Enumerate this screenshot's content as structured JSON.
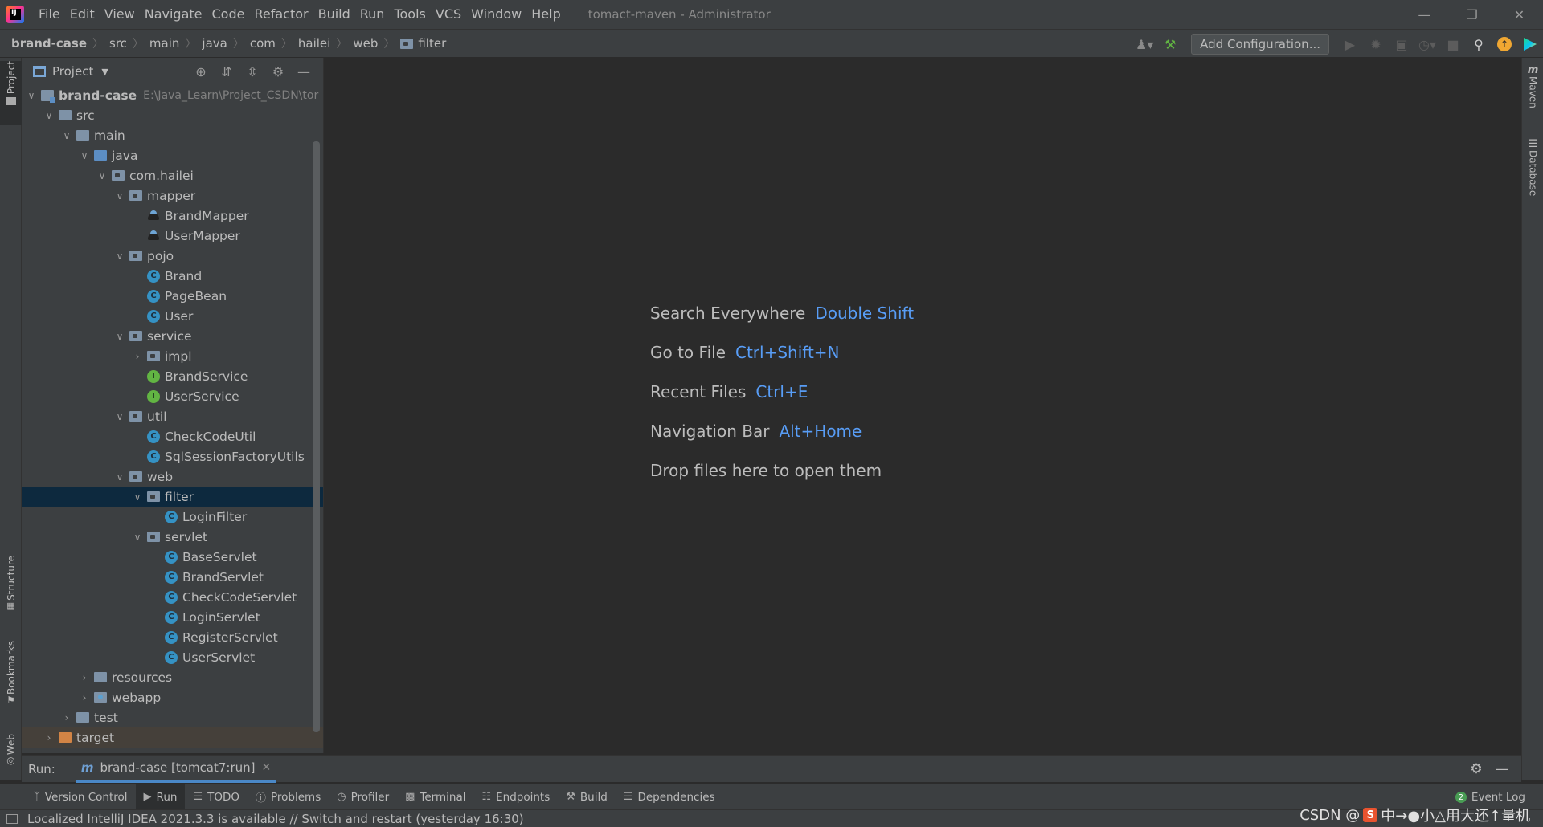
{
  "menubar": {
    "items": [
      "File",
      "Edit",
      "View",
      "Navigate",
      "Code",
      "Refactor",
      "Build",
      "Run",
      "Tools",
      "VCS",
      "Window",
      "Help"
    ],
    "window_title": "tomact-maven - Administrator"
  },
  "navbar": {
    "crumbs": [
      "brand-case",
      "src",
      "main",
      "java",
      "com",
      "hailei",
      "web",
      "filter"
    ],
    "config_label": "Add Configuration..."
  },
  "project_panel": {
    "title": "Project",
    "tree": [
      {
        "label": "brand-case",
        "hint": "E:\\Java_Learn\\Project_CSDN\\tor"
      },
      {
        "label": "src"
      },
      {
        "label": "main"
      },
      {
        "label": "java"
      },
      {
        "label": "com.hailei"
      },
      {
        "label": "mapper"
      },
      {
        "label": "BrandMapper"
      },
      {
        "label": "UserMapper"
      },
      {
        "label": "pojo"
      },
      {
        "label": "Brand"
      },
      {
        "label": "PageBean"
      },
      {
        "label": "User"
      },
      {
        "label": "service"
      },
      {
        "label": "impl"
      },
      {
        "label": "BrandService"
      },
      {
        "label": "UserService"
      },
      {
        "label": "util"
      },
      {
        "label": "CheckCodeUtil"
      },
      {
        "label": "SqlSessionFactoryUtils"
      },
      {
        "label": "web"
      },
      {
        "label": "filter"
      },
      {
        "label": "LoginFilter"
      },
      {
        "label": "servlet"
      },
      {
        "label": "BaseServlet"
      },
      {
        "label": "BrandServlet"
      },
      {
        "label": "CheckCodeServlet"
      },
      {
        "label": "LoginServlet"
      },
      {
        "label": "RegisterServlet"
      },
      {
        "label": "UserServlet"
      },
      {
        "label": "resources"
      },
      {
        "label": "webapp"
      },
      {
        "label": "test"
      },
      {
        "label": "target"
      }
    ]
  },
  "left_stripe": {
    "project": "Project",
    "structure": "Structure",
    "bookmarks": "Bookmarks",
    "web": "Web"
  },
  "right_stripe": {
    "maven": "Maven",
    "database": "Database"
  },
  "editor_hints": [
    {
      "action": "Search Everywhere",
      "key": "Double Shift"
    },
    {
      "action": "Go to File",
      "key": "Ctrl+Shift+N"
    },
    {
      "action": "Recent Files",
      "key": "Ctrl+E"
    },
    {
      "action": "Navigation Bar",
      "key": "Alt+Home"
    },
    {
      "action": "Drop files here to open them",
      "key": ""
    }
  ],
  "run_bar": {
    "label": "Run:",
    "tab": "brand-case [tomcat7:run]"
  },
  "tool_windows": [
    "Version Control",
    "Run",
    "TODO",
    "Problems",
    "Profiler",
    "Terminal",
    "Endpoints",
    "Build",
    "Dependencies"
  ],
  "event_log": {
    "label": "Event Log",
    "count": "2"
  },
  "status": {
    "message": "Localized IntelliJ IDEA 2021.3.3 is available // Switch and restart (yesterday 16:30)"
  },
  "watermark": {
    "text": "CSDN @",
    "tail": "中→●小△用大还↑量机"
  },
  "colors": {
    "accent": "#589df6",
    "selection": "#0d293e",
    "panel": "#3c3f41",
    "editor": "#2b2b2b"
  }
}
